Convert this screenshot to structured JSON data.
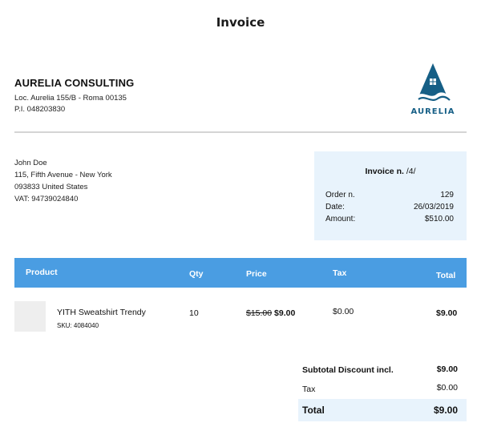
{
  "title": "Invoice",
  "company": {
    "name": "AURELIA CONSULTING",
    "address": "Loc. Aurelia 155/B - Roma 00135",
    "vat": "P.I. 048203830",
    "logo_text": "AURELIA",
    "brand_color": "#165f86"
  },
  "customer": {
    "name": "John Doe",
    "street": "115, Fifth Avenue - New York",
    "postal_country": "093833 United States",
    "vat": "VAT: 94739024840"
  },
  "invoice": {
    "title_label": "Invoice n.",
    "number": "/4/",
    "order_label": "Order n.",
    "order_value": "129",
    "date_label": "Date:",
    "date_value": "26/03/2019",
    "amount_label": "Amount:",
    "amount_value": "$510.00"
  },
  "table": {
    "header_color": "#4a9de2",
    "headers": {
      "product": "Product",
      "qty": "Qty",
      "price": "Price",
      "tax": "Tax",
      "total": "Total"
    },
    "rows": [
      {
        "product": "YITH Sweatshirt Trendy",
        "sku": "SKU: 4084040",
        "qty": "10",
        "price_old": "$15.00",
        "price_new": "$9.00",
        "tax": "$0.00",
        "total": "$9.00"
      }
    ]
  },
  "summary": {
    "subtotal_label": "Subtotal Discount incl.",
    "subtotal_value": "$9.00",
    "tax_label": "Tax",
    "tax_value": "$0.00",
    "total_label": "Total",
    "total_value": "$9.00"
  }
}
